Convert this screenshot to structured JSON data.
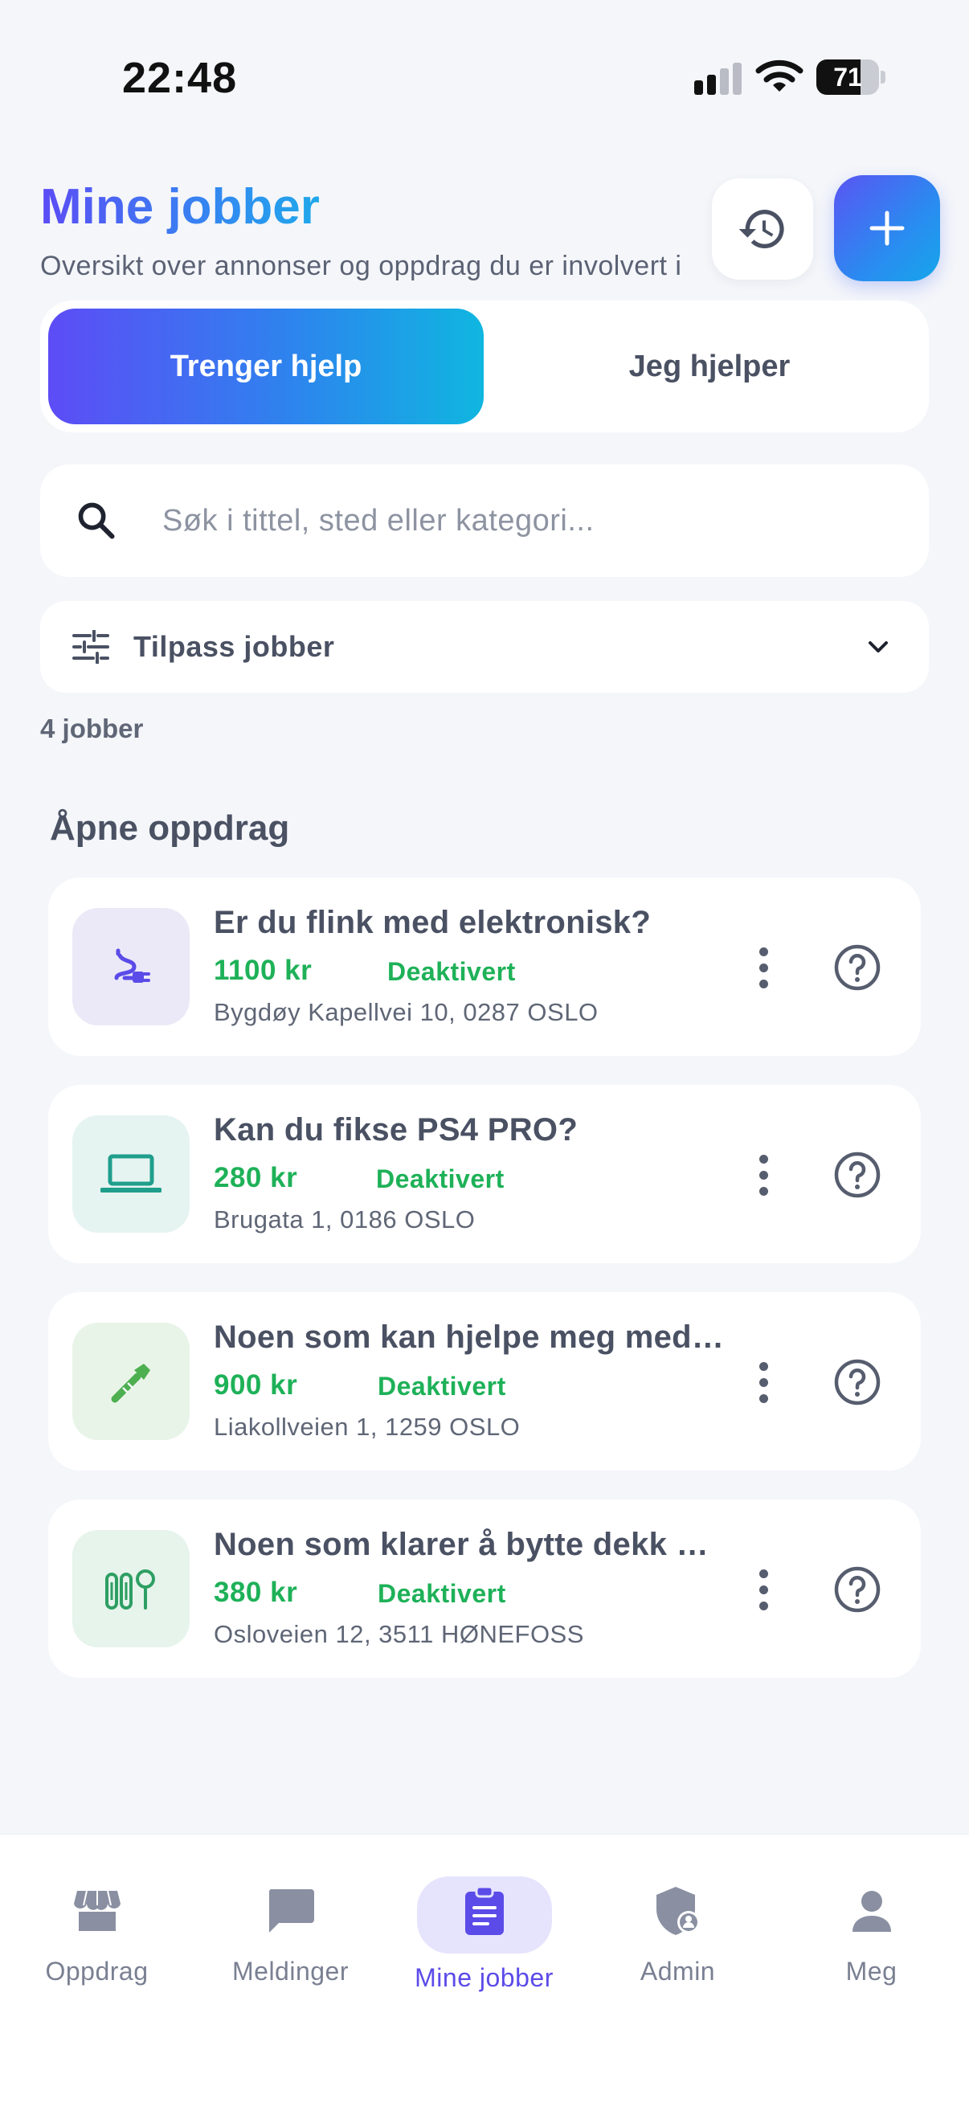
{
  "status_bar": {
    "time": "22:48",
    "battery": "71",
    "battery_level": 0.71
  },
  "header": {
    "title": "Mine jobber",
    "subtitle": "Oversikt over annonser og oppdrag du er involvert i",
    "history_icon": "history-icon",
    "add_icon": "plus-icon"
  },
  "tabs": [
    {
      "label": "Trenger hjelp",
      "active": true
    },
    {
      "label": "Jeg hjelper",
      "active": false
    }
  ],
  "search": {
    "placeholder": "Søk i tittel, sted eller kategori...",
    "value": ""
  },
  "filter": {
    "label": "Tilpass jobber"
  },
  "count_label": "4 jobber",
  "section_title": "Åpne oppdrag",
  "colors": {
    "accent": "#5b4be8",
    "price_green": "#1eb158",
    "gradient_start": "#5d4cf6",
    "gradient_end": "#0fb6e0"
  },
  "jobs": [
    {
      "title": "Er du flink med elektronisk?",
      "price": "1100 kr",
      "status": "Deaktivert",
      "address": "Bygdøy Kapellvei 10, 0287 OSLO",
      "icon": "plug-icon",
      "thumb_color": "#ebe9f7"
    },
    {
      "title": "Kan du fikse PS4 PRO?",
      "price": "280 kr",
      "status": "Deaktivert",
      "address": "Brugata 1, 0186 OSLO",
      "icon": "laptop-icon",
      "thumb_color": "#e6f4f1"
    },
    {
      "title": "Noen som kan hjelpe meg med rørleggerarbeid?",
      "price": "900 kr",
      "status": "Deaktivert",
      "address": "Liakollveien 1, 1259 OSLO",
      "icon": "wrench-icon",
      "thumb_color": "#e9f4e8"
    },
    {
      "title": "Noen som klarer å bytte dekk på bilen?",
      "price": "380 kr",
      "status": "Deaktivert",
      "address": "Osloveien 12, 3511 HØNEFOSS",
      "icon": "garden-icon",
      "thumb_color": "#e6f4ec"
    }
  ],
  "nav": [
    {
      "label": "Oppdrag",
      "icon": "store-icon",
      "active": false
    },
    {
      "label": "Meldinger",
      "icon": "chat-icon",
      "active": false
    },
    {
      "label": "Mine jobber",
      "icon": "clipboard-icon",
      "active": true
    },
    {
      "label": "Admin",
      "icon": "admin-shield-icon",
      "active": false
    },
    {
      "label": "Meg",
      "icon": "person-icon",
      "active": false
    }
  ]
}
